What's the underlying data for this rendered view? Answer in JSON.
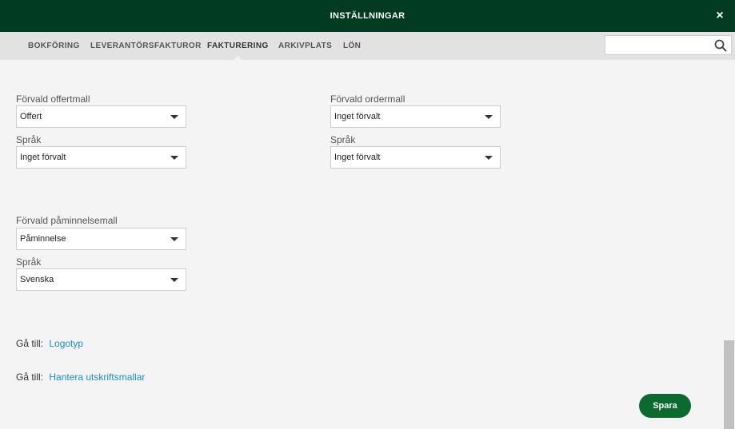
{
  "window": {
    "title": "INSTÄLLNINGAR",
    "close_label": "×"
  },
  "tabs": [
    {
      "label": "BOKFÖRING"
    },
    {
      "label": "LEVERANTÖRSFAKTUROR"
    },
    {
      "label": "FAKTURERING",
      "active": true
    },
    {
      "label": "ARKIVPLATS"
    },
    {
      "label": "LÖN"
    }
  ],
  "search": {
    "value": "",
    "placeholder": ""
  },
  "offer": {
    "template_label": "Förvald offertmall",
    "template_value": "Offert",
    "language_label": "Språk",
    "language_value": "Inget förvalt"
  },
  "order": {
    "template_label": "Förvald ordermall",
    "template_value": "Inget förvalt",
    "language_label": "Språk",
    "language_value": "Inget förvalt"
  },
  "reminder": {
    "template_label": "Förvald påminnelsemall",
    "template_value": "Påminnelse",
    "language_label": "Språk",
    "language_value": "Svenska"
  },
  "links": [
    {
      "prefix": "Gå till:",
      "text": "Logotyp"
    },
    {
      "prefix": "Gå till:",
      "text": "Hantera utskriftsmallar"
    }
  ],
  "actions": {
    "save_label": "Spara"
  },
  "colors": {
    "header": "#003b22",
    "tabbar": "#e2e2e2",
    "link": "#1a8fc9",
    "save": "#0b6b2e"
  }
}
